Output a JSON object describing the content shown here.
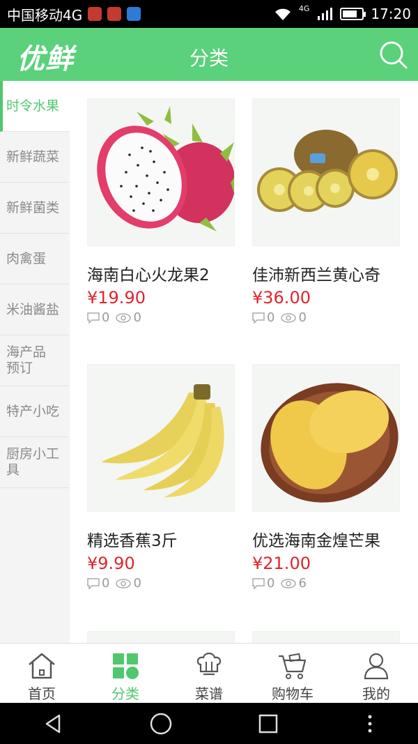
{
  "status_bar": {
    "carrier": "中国移动4G",
    "network": "4G",
    "time": "17:20"
  },
  "header": {
    "logo": "优鲜",
    "title": "分类",
    "search_icon": "search-icon"
  },
  "sidebar": {
    "items": [
      {
        "label": "时令水果",
        "active": true
      },
      {
        "label": "新鲜蔬菜",
        "active": false
      },
      {
        "label": "新鲜菌类",
        "active": false
      },
      {
        "label": "肉禽蛋",
        "active": false
      },
      {
        "label": "米油酱盐",
        "active": false
      },
      {
        "label": "海产品预订",
        "active": false
      },
      {
        "label": "特产小吃",
        "active": false
      },
      {
        "label": "厨房小工具",
        "active": false
      }
    ]
  },
  "products": [
    {
      "name": "海南白心火龙果2",
      "price": "¥19.90",
      "comments": "0",
      "views": "0",
      "image": "dragon-fruit"
    },
    {
      "name": "佳沛新西兰黄心奇",
      "price": "¥36.00",
      "comments": "0",
      "views": "0",
      "image": "kiwi"
    },
    {
      "name": "精选香蕉3斤",
      "price": "¥9.90",
      "comments": "0",
      "views": "0",
      "image": "banana"
    },
    {
      "name": "优选海南金煌芒果",
      "price": "¥21.00",
      "comments": "0",
      "views": "6",
      "image": "mango"
    }
  ],
  "bottom_nav": {
    "items": [
      {
        "label": "首页",
        "icon": "home-icon",
        "active": false
      },
      {
        "label": "分类",
        "icon": "category-icon",
        "active": true
      },
      {
        "label": "菜谱",
        "icon": "recipe-icon",
        "active": false
      },
      {
        "label": "购物车",
        "icon": "cart-icon",
        "active": false
      },
      {
        "label": "我的",
        "icon": "profile-icon",
        "active": false
      }
    ]
  },
  "colors": {
    "accent": "#5ad17a",
    "price": "#e0242c"
  }
}
